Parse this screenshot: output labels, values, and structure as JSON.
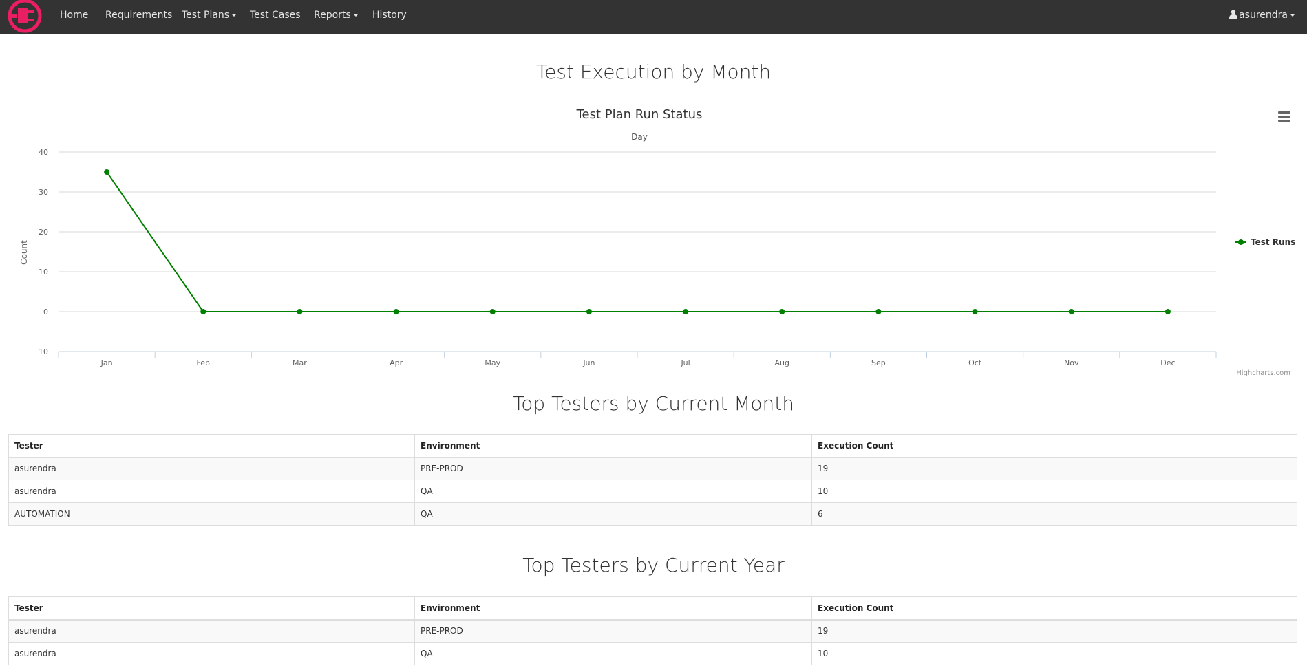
{
  "navbar": {
    "items": [
      {
        "label": "Home"
      },
      {
        "label": "Requirements"
      },
      {
        "label": "Test Plans",
        "dropdown": true
      },
      {
        "label": "Test Cases"
      },
      {
        "label": "Reports",
        "dropdown": true
      },
      {
        "label": "History"
      }
    ],
    "user": "asurendra",
    "logo_color": "#e91e63",
    "background": "#333333"
  },
  "page": {
    "title": "Test Execution by Month"
  },
  "chart_data": {
    "type": "line",
    "title": "Test Plan Run Status",
    "subtitle": "Day",
    "xlabel": "",
    "ylabel": "Count",
    "categories": [
      "Jan",
      "Feb",
      "Mar",
      "Apr",
      "May",
      "Jun",
      "Jul",
      "Aug",
      "Sep",
      "Oct",
      "Nov",
      "Dec"
    ],
    "series": [
      {
        "name": "Test Runs",
        "values": [
          35,
          0,
          0,
          0,
          0,
          0,
          0,
          0,
          0,
          0,
          0,
          0
        ],
        "color": "#008000"
      }
    ],
    "yticks": [
      "40",
      "30",
      "20",
      "10",
      "0",
      "−10"
    ],
    "ylim": [
      -10,
      40
    ],
    "grid": true,
    "legend": "right",
    "credits": "Highcharts.com"
  },
  "monthly": {
    "title": "Top Testers by Current Month",
    "headers": [
      "Tester",
      "Environment",
      "Execution Count"
    ],
    "rows": [
      [
        "asurendra",
        "PRE-PROD",
        "19"
      ],
      [
        "asurendra",
        "QA",
        "10"
      ],
      [
        "AUTOMATION",
        "QA",
        "6"
      ]
    ]
  },
  "yearly": {
    "title": "Top Testers by Current Year",
    "headers": [
      "Tester",
      "Environment",
      "Execution Count"
    ],
    "rows": [
      [
        "asurendra",
        "PRE-PROD",
        "19"
      ],
      [
        "asurendra",
        "QA",
        "10"
      ]
    ]
  }
}
